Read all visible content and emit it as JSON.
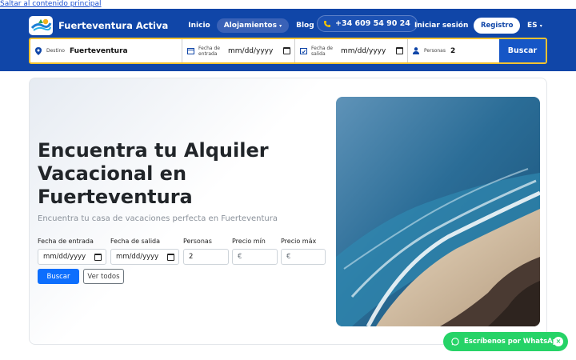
{
  "skip_link": "Saltar al contenido principal",
  "nav": {
    "brand": "Fuerteventura Activa",
    "links": [
      "Inicio",
      "Alojamientos",
      "Blog"
    ],
    "phone": "+34 609 54 90 24",
    "login": "Iniciar sesión",
    "register": "Registro",
    "language": "ES"
  },
  "searchbar": {
    "destination_label": "Destino",
    "destination_value": "Fuerteventura",
    "checkin_label_1": "Fecha de",
    "checkin_label_2": "entrada",
    "checkin_value": "mm/dd/yyyy",
    "checkout_label_1": "Fecha de",
    "checkout_label_2": "salida",
    "checkout_value": "mm/dd/yyyy",
    "guests_label": "Personas",
    "guests_value": "2",
    "search_button": "Buscar"
  },
  "hero": {
    "title": "Encuentra tu Alquiler Vacacional en Fuerteventura",
    "subtitle": "Encuentra tu casa de vacaciones perfecta en Fuerteventura",
    "filters": {
      "checkin_label": "Fecha de entrada",
      "checkin_value": "mm/dd/yyyy",
      "checkout_label": "Fecha de salida",
      "checkout_value": "mm/dd/yyyy",
      "guests_label": "Personas",
      "guests_value": "2",
      "price_min_label": "Precio mín",
      "price_min_value": "€",
      "price_max_label": "Precio máx",
      "price_max_value": "€"
    },
    "search_button": "Buscar",
    "view_all_button": "Ver todos",
    "image_icon": "beach-coast-photo"
  },
  "whatsapp": {
    "label": "Escríbenos por WhatsApp",
    "close": "×"
  },
  "colors": {
    "header": "#1046a8",
    "accent_border": "#f2c230",
    "primary": "#0d6efd",
    "whatsapp": "#26d367"
  }
}
